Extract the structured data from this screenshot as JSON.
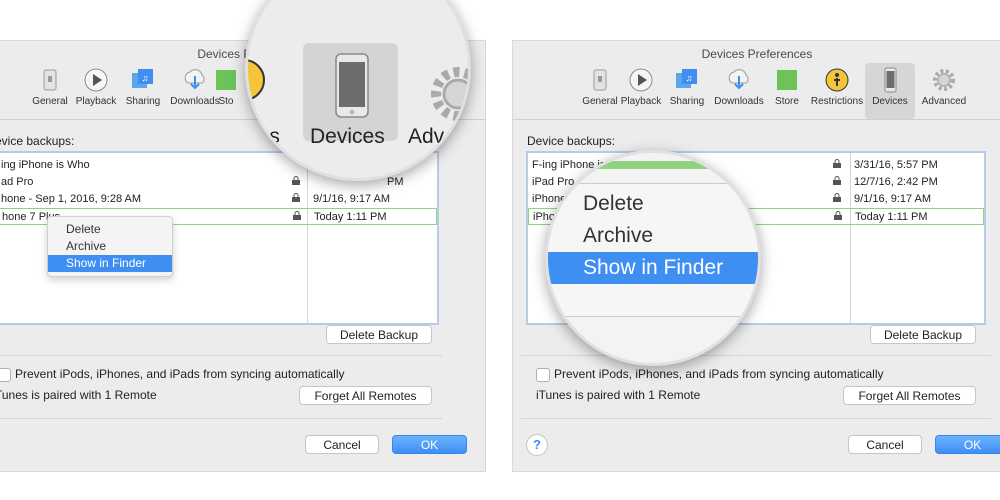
{
  "window_title": "Devices Preferences",
  "left_window_title": "Devices Prefere",
  "toolbar": {
    "general": "General",
    "playback": "Playback",
    "sharing": "Sharing",
    "downloads": "Downloads",
    "store": "Store",
    "store_left_partial": "Sto",
    "restrictions": "Restrictions",
    "devices": "Devices",
    "advanced": "Advanced"
  },
  "left": {
    "section_label": "evice backups:",
    "rows": [
      {
        "name": "ing iPhone is Who",
        "date": ""
      },
      {
        "name": "ad Pro",
        "date": ""
      },
      {
        "name": "hone - Sep 1, 2016, 9:28 AM",
        "date": "9/1/16, 9:17 AM"
      },
      {
        "name": "hone 7 Plus",
        "date": "Today 1:11 PM"
      }
    ],
    "partial_date_row1": "PM",
    "context_menu": [
      "Delete",
      "Archive",
      "Show in Finder"
    ],
    "delete_backup": "Delete Backup",
    "prevent_label": "Prevent iPods, iPhones, and iPads from syncing automatically",
    "paired_label": "Tunes is paired with 1 Remote",
    "forget_remotes": "Forget All Remotes",
    "cancel": "Cancel",
    "ok": "OK",
    "loupe": {
      "left_word": "ons",
      "center_word": "Devices",
      "right_word": "Adv"
    }
  },
  "right": {
    "section_label": "Device backups:",
    "rows": [
      {
        "name": "F-ing iPhone is",
        "date": "3/31/16, 5:57 PM"
      },
      {
        "name": "iPad Pro",
        "date": "12/7/16, 2:42 PM"
      },
      {
        "name": "iPhone",
        "date": "9/1/16, 9:17 AM"
      },
      {
        "name": "iPho",
        "date": "Today 1:11 PM"
      }
    ],
    "loupe_menu": [
      "Delete",
      "Archive",
      "Show in Finder"
    ],
    "delete_backup": "Delete Backup",
    "prevent_label": "Prevent iPods, iPhones, and iPads from syncing automatically",
    "paired_label": "iTunes is paired with 1 Remote",
    "forget_remotes": "Forget All Remotes",
    "help": "?",
    "cancel": "Cancel",
    "ok": "OK"
  },
  "colors": {
    "window_bg": "#ececec",
    "accent_blue": "#3f8ff3",
    "selection_green": "#8fd27f",
    "list_border": "#b8cbe6"
  }
}
